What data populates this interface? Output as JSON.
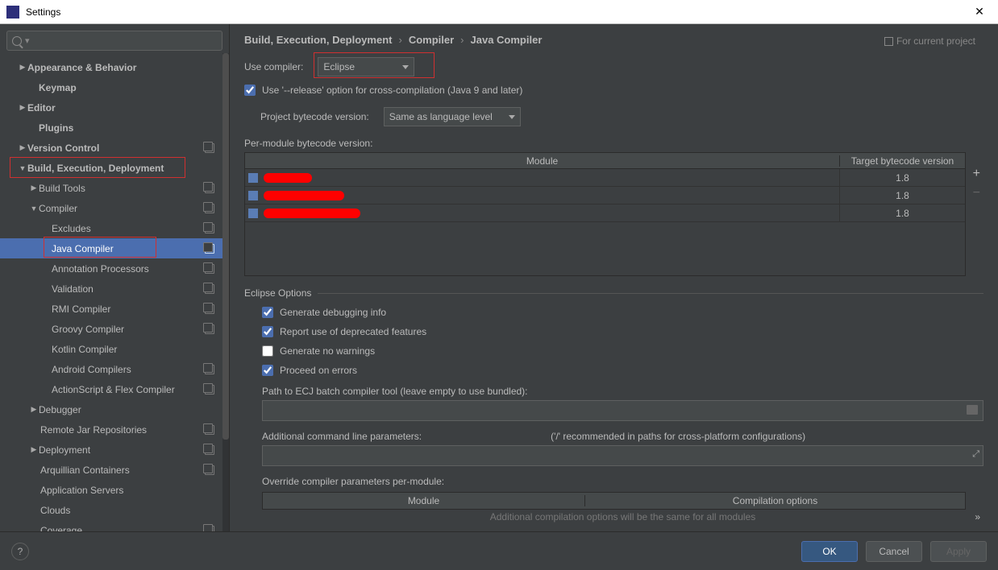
{
  "window": {
    "title": "Settings"
  },
  "search": {
    "placeholder": ""
  },
  "tree": {
    "appearance": "Appearance & Behavior",
    "keymap": "Keymap",
    "editor": "Editor",
    "plugins": "Plugins",
    "vcs": "Version Control",
    "bed": "Build, Execution, Deployment",
    "build_tools": "Build Tools",
    "compiler": "Compiler",
    "excludes": "Excludes",
    "java_compiler": "Java Compiler",
    "annotation": "Annotation Processors",
    "validation": "Validation",
    "rmi": "RMI Compiler",
    "groovy": "Groovy Compiler",
    "kotlin": "Kotlin Compiler",
    "android": "Android Compilers",
    "asflex": "ActionScript & Flex Compiler",
    "debugger": "Debugger",
    "remote_jar": "Remote Jar Repositories",
    "deployment": "Deployment",
    "arquillian": "Arquillian Containers",
    "appservers": "Application Servers",
    "clouds": "Clouds",
    "coverage": "Coverage"
  },
  "breadcrumb": {
    "a": "Build, Execution, Deployment",
    "b": "Compiler",
    "c": "Java Compiler"
  },
  "project_hint": "For current project",
  "use_compiler_label": "Use compiler:",
  "use_compiler_value": "Eclipse",
  "chk_release": "Use '--release' option for cross-compilation (Java 9 and later)",
  "project_bytecode_label": "Project bytecode version:",
  "project_bytecode_value": "Same as language level",
  "permodule_label": "Per-module bytecode version:",
  "table_hdr_module": "Module",
  "table_hdr_target": "Target bytecode version",
  "modules": [
    {
      "target": "1.8"
    },
    {
      "target": "1.8"
    },
    {
      "target": "1.8"
    }
  ],
  "eclipse_options_label": "Eclipse Options",
  "opt_debug": "Generate debugging info",
  "opt_deprecated": "Report use of deprecated features",
  "opt_nowarn": "Generate no warnings",
  "opt_proceed": "Proceed on errors",
  "ecj_path_label": "Path to ECJ batch compiler tool (leave empty to use bundled):",
  "add_cmdline_label": "Additional command line parameters:",
  "add_cmdline_hint": "('/' recommended in paths for cross-platform configurations)",
  "override_label": "Override compiler parameters per-module:",
  "override_hdr_module": "Module",
  "override_hdr_opts": "Compilation options",
  "override_note": "Additional compilation options will be the same for all modules",
  "buttons": {
    "ok": "OK",
    "cancel": "Cancel",
    "apply": "Apply",
    "help": "?"
  }
}
